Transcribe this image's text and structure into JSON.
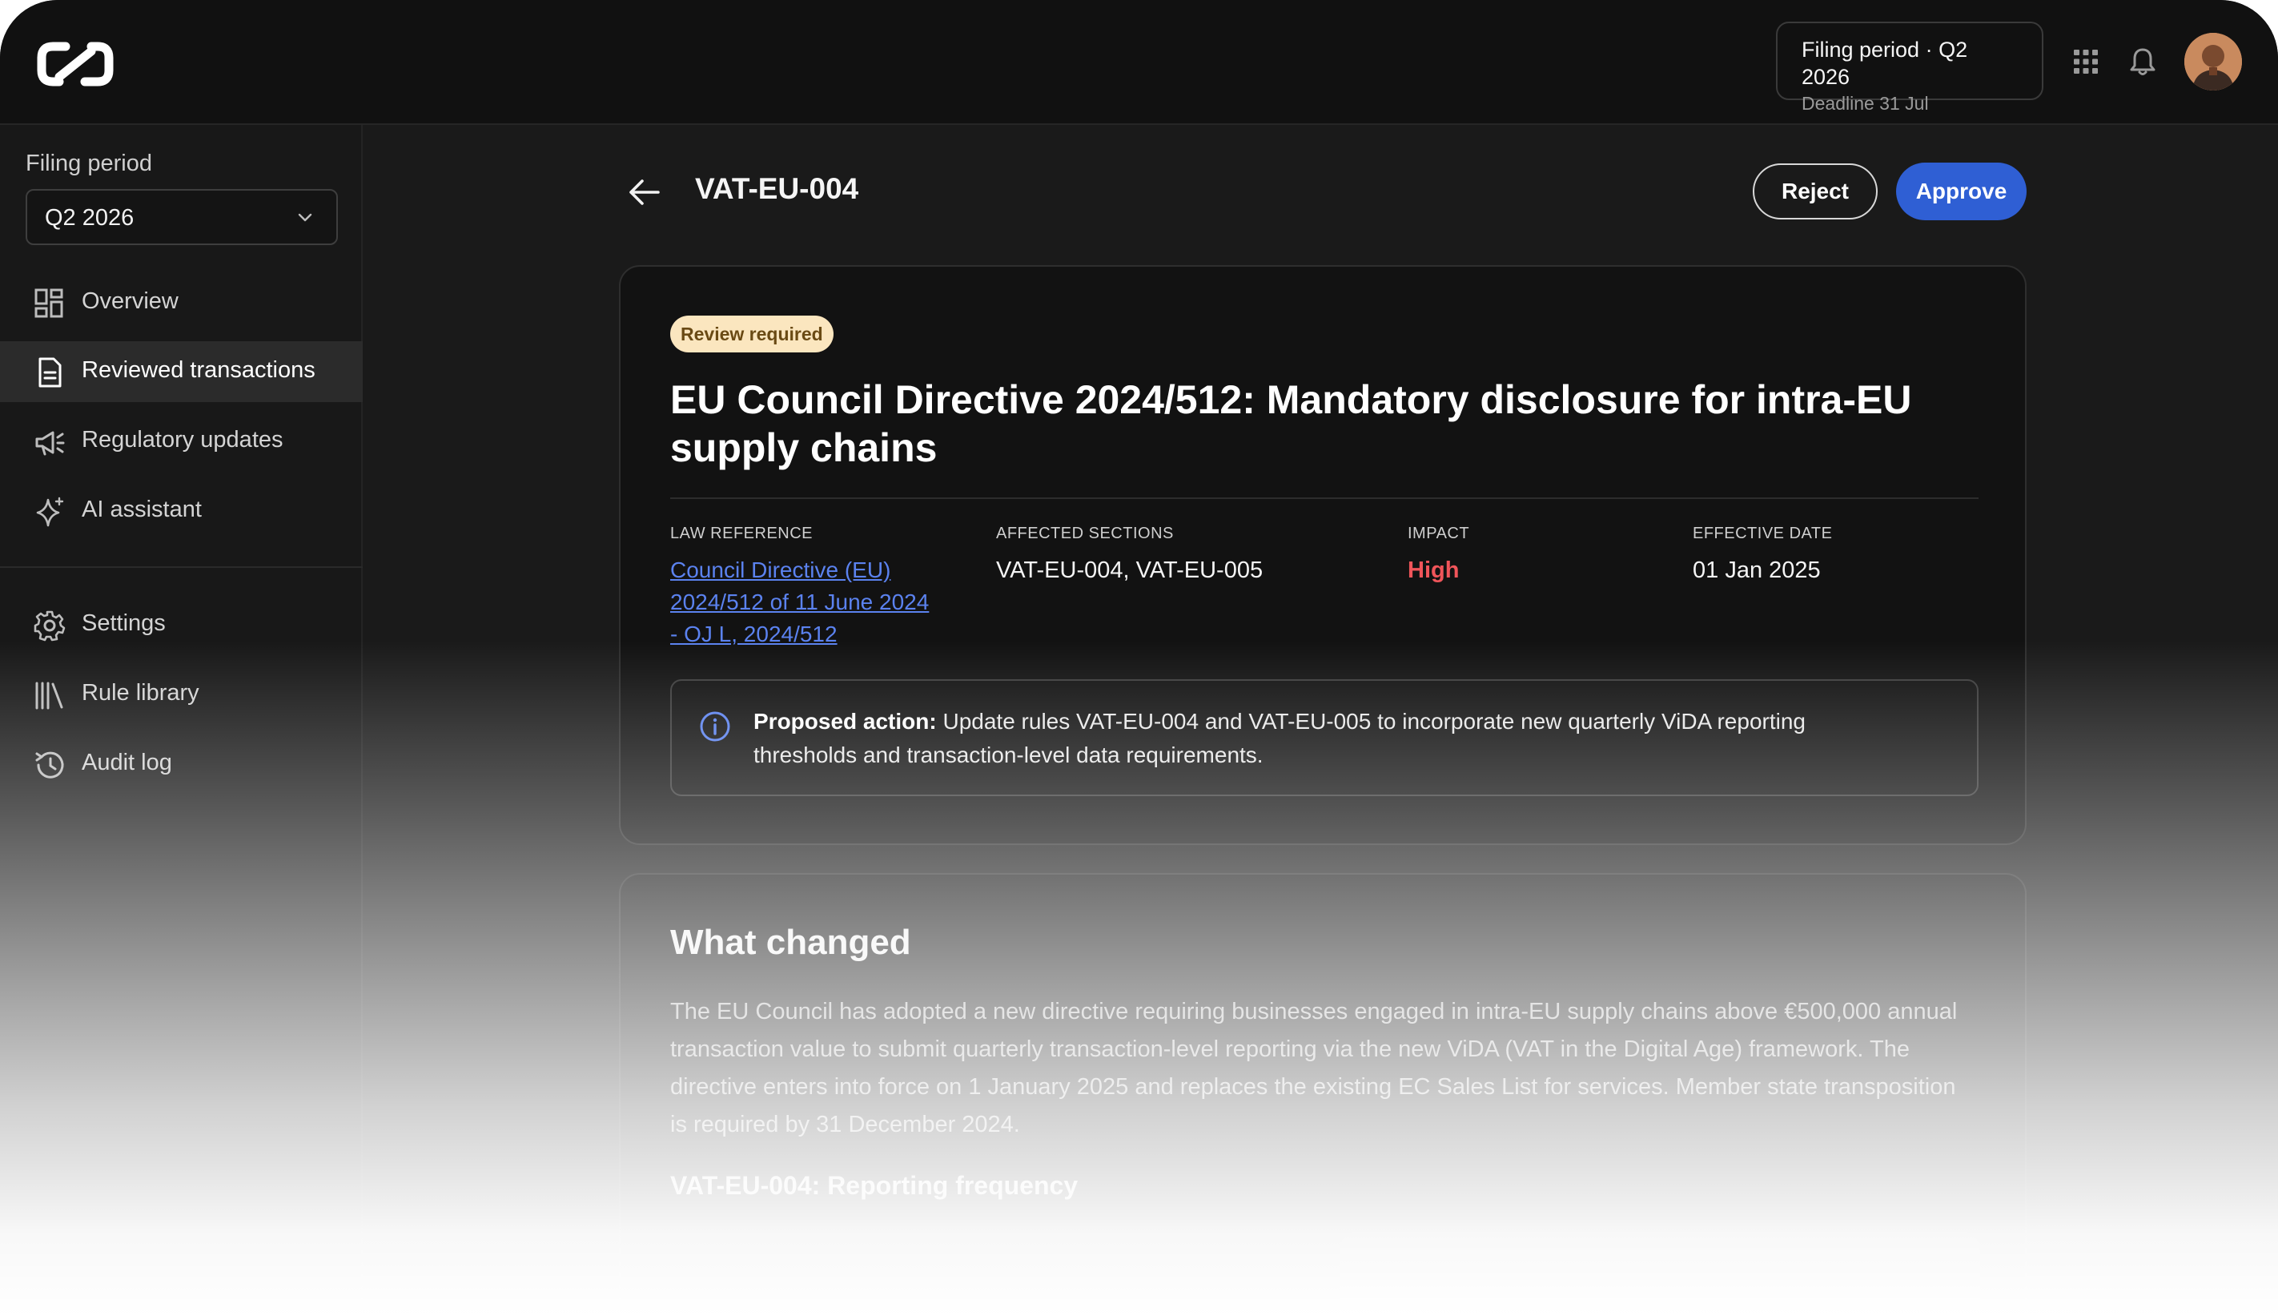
{
  "header": {
    "filing_chip": {
      "line1": "Filing period · Q2 2026",
      "line2": "Deadline 31 Jul"
    },
    "icons": [
      "logo-icon",
      "apps-grid-icon",
      "bell-icon",
      "avatar"
    ]
  },
  "sidebar": {
    "period_label": "Filing period",
    "period_value": "Q2 2026",
    "items": [
      {
        "label": "Overview",
        "icon": "dashboard-icon",
        "active": false
      },
      {
        "label": "Reviewed transactions",
        "icon": "document-icon",
        "active": true
      },
      {
        "label": "Regulatory updates",
        "icon": "megaphone-icon",
        "active": false
      },
      {
        "label": "AI assistant",
        "icon": "sparkle-icon",
        "active": false
      }
    ],
    "secondary_items": [
      {
        "label": "Settings",
        "icon": "gear-icon"
      },
      {
        "label": "Rule library",
        "icon": "library-icon"
      },
      {
        "label": "Audit log",
        "icon": "history-icon"
      }
    ]
  },
  "page": {
    "title": "VAT-EU-004",
    "reject_label": "Reject",
    "approve_label": "Approve"
  },
  "detail": {
    "badge": "Review required",
    "title": "EU Council Directive 2024/512: Mandatory disclosure for intra-EU supply chains",
    "law_reference_label": "LAW REFERENCE",
    "law_reference_value": "Council Directive (EU) 2024/512 of 11 June 2024 - OJ L, 2024/512",
    "affected_sections_label": "AFFECTED SECTIONS",
    "affected_sections_value": "VAT-EU-004, VAT-EU-005",
    "impact_label": "IMPACT",
    "impact_value": "High",
    "effective_date_label": "EFFECTIVE DATE",
    "effective_date_value": "01 Jan 2025",
    "proposed_action_label": "Proposed action:",
    "proposed_action_text": "Update rules VAT-EU-004 and VAT-EU-005 to incorporate new quarterly ViDA reporting thresholds and transaction-level data requirements."
  },
  "what_changed": {
    "title": "What changed",
    "body": "The EU Council has adopted a new directive requiring businesses engaged in intra-EU supply chains above €500,000 annual transaction value to submit quarterly transaction-level reporting via the new ViDA (VAT in the Digital Age) framework. The directive enters into force on 1 January 2025 and replaces the existing EC Sales List for services. Member state transposition is required by 31 December 2024.",
    "rule_heading": "VAT-EU-004: Reporting frequency"
  },
  "colors": {
    "accent": "#2f5fd4",
    "link": "#5b82ef",
    "impact_high": "#f0555a",
    "badge_bg": "#fbe6bf",
    "badge_text": "#6a4a14"
  }
}
